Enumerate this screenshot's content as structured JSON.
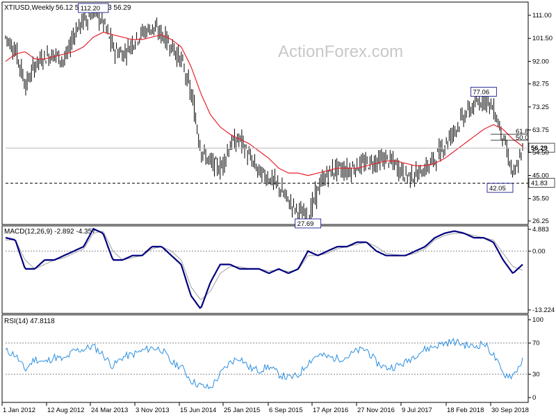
{
  "header": {
    "symbol": "XTIUSD,Weekly",
    "ohlc": "56.12 56.68 56.03 56.29",
    "macd_label": "MACD(12,26,9) -2.892 -4.357",
    "rsi_label": "RSI(14) 47.8118"
  },
  "watermark": "ActionForex.com",
  "colors": {
    "candle": "#000000",
    "sma": "#e8202a",
    "macd": "#000080",
    "signal": "#a0a0a0",
    "rsi": "#2b8ee0",
    "axis": "#000000",
    "annotation": "#000080"
  },
  "chart_data": [
    {
      "type": "candlestick",
      "panel": "price",
      "ylim": [
        26.25,
        111.0
      ],
      "y_ticks": [
        "111.00",
        "101.50",
        "92.00",
        "82.75",
        "73.25",
        "63.75",
        "54.50",
        "45.00",
        "35.50",
        "26.25"
      ],
      "x_labels": [
        "1 Jan 2012",
        "12 Aug 2012",
        "24 Mar 2013",
        "3 Nov 2013",
        "15 Jun 2014",
        "25 Jan 2015",
        "6 Sep 2015",
        "17 Apr 2016",
        "27 Nov 2016",
        "9 Jul 2017",
        "18 Feb 2018",
        "30 Sep 2018"
      ],
      "close_series": [
        102,
        96,
        82,
        91,
        94,
        95,
        92,
        104,
        109,
        112.2,
        108,
        97,
        95,
        100,
        104,
        106,
        103,
        98,
        92,
        78,
        55,
        50,
        48,
        58,
        60,
        52,
        46,
        44,
        40,
        34,
        30,
        27.69,
        40,
        46,
        48,
        47,
        49,
        50,
        51,
        52,
        49,
        45,
        45,
        48,
        52,
        58,
        64,
        70,
        74,
        77.06,
        72,
        60,
        44,
        56.29
      ],
      "sma_series": [
        92,
        95,
        96,
        93,
        93,
        94,
        95,
        96,
        98,
        102,
        104,
        103,
        102,
        101,
        101,
        102,
        103,
        101,
        98,
        90,
        79,
        70,
        65,
        62,
        60,
        58,
        55,
        52,
        48,
        46,
        46,
        45,
        46,
        47,
        48,
        48,
        48,
        49,
        50,
        51,
        51,
        50,
        49,
        49,
        50,
        52,
        55,
        58,
        61,
        64,
        66,
        64,
        60,
        57
      ],
      "annotations": [
        {
          "label": "112.20",
          "value": 112.2,
          "at": 9
        },
        {
          "label": "27.69",
          "value": 27.69,
          "at": 31
        },
        {
          "label": "77.06",
          "value": 77.06,
          "at": 49
        },
        {
          "label": "42.05",
          "value": 42.05,
          "at": 52
        }
      ],
      "levels": [
        {
          "label": "41.83",
          "value": 41.83,
          "style": "dashed"
        },
        {
          "label": "56.29",
          "value": 56.29,
          "style": "solid"
        }
      ],
      "fibonacci": [
        {
          "label": "61.8",
          "value": 62.0
        },
        {
          "label": "50.0",
          "value": 59.5
        }
      ]
    },
    {
      "type": "line",
      "panel": "macd",
      "ylim": [
        -13.224,
        4.883
      ],
      "y_ticks": [
        "4.883",
        "0.00",
        "-13.224"
      ],
      "series": [
        {
          "values": [
            3,
            2.5,
            -4,
            -4,
            -2,
            -2,
            -1,
            0,
            1,
            5,
            4,
            -2,
            -2,
            -1,
            -1,
            1,
            1,
            -1,
            -3,
            -10,
            -13,
            -7,
            -3,
            -3,
            -4,
            -4,
            -4,
            -5,
            -4,
            -5,
            -4,
            0,
            -1,
            0,
            1,
            1,
            2,
            2,
            0,
            -1,
            -1,
            -1,
            0,
            1,
            3,
            4,
            4.5,
            4,
            3,
            3,
            2,
            -2,
            -5,
            -3
          ]
        },
        {
          "values": [
            2.5,
            2.5,
            -2,
            -4,
            -3,
            -2,
            -1.5,
            -0.5,
            0.5,
            4,
            4.5,
            0,
            -2,
            -1.5,
            -1,
            0.5,
            1,
            0,
            -2,
            -8,
            -11,
            -9,
            -5,
            -3.5,
            -3.5,
            -4,
            -4,
            -4.5,
            -4.2,
            -4.6,
            -4.2,
            -1,
            -1,
            -0.5,
            0.5,
            1,
            1.5,
            2,
            1,
            -0.5,
            -0.8,
            -1,
            -0.5,
            0.5,
            2.5,
            3.5,
            4,
            4,
            3.5,
            3,
            2.5,
            -0.5,
            -3.5,
            -4.3
          ]
        }
      ]
    },
    {
      "type": "line",
      "panel": "rsi",
      "ylim": [
        0,
        100
      ],
      "y_ticks": [
        "100",
        "70",
        "30",
        "0"
      ],
      "levels": [
        70,
        30
      ],
      "series": [
        {
          "values": [
            60,
            55,
            35,
            50,
            45,
            52,
            48,
            60,
            62,
            66,
            55,
            40,
            52,
            55,
            60,
            64,
            62,
            45,
            40,
            22,
            15,
            12,
            30,
            45,
            52,
            38,
            35,
            40,
            30,
            25,
            28,
            45,
            55,
            52,
            50,
            52,
            60,
            62,
            45,
            38,
            40,
            45,
            55,
            62,
            66,
            70,
            72,
            68,
            65,
            70,
            55,
            30,
            28,
            47.81
          ]
        }
      ]
    }
  ]
}
